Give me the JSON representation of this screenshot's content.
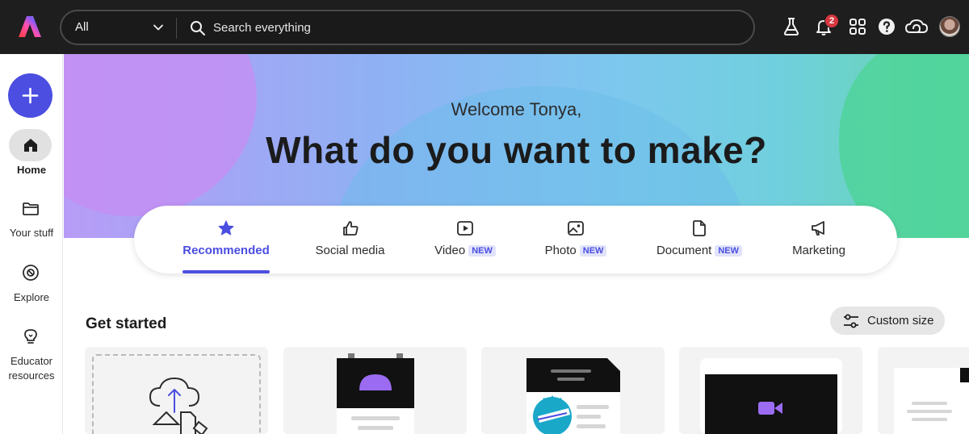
{
  "topbar": {
    "search_scope": "All",
    "search_placeholder": "Search everything",
    "notification_count": "2"
  },
  "sidebar": {
    "items": [
      {
        "label": "Home"
      },
      {
        "label": "Your stuff"
      },
      {
        "label": "Explore"
      },
      {
        "label": "Educator resources"
      }
    ]
  },
  "hero": {
    "welcome": "Welcome Tonya,",
    "headline": "What do you want to make?"
  },
  "tabs": [
    {
      "label": "Recommended",
      "badge": ""
    },
    {
      "label": "Social media",
      "badge": ""
    },
    {
      "label": "Video",
      "badge": "NEW"
    },
    {
      "label": "Photo",
      "badge": "NEW"
    },
    {
      "label": "Document",
      "badge": "NEW"
    },
    {
      "label": "Marketing",
      "badge": ""
    }
  ],
  "get_started": {
    "title": "Get started",
    "custom_size_label": "Custom size"
  },
  "colors": {
    "accent": "#4b4ee0",
    "topbar": "#1e1e1e",
    "badge": "#d7373f"
  }
}
